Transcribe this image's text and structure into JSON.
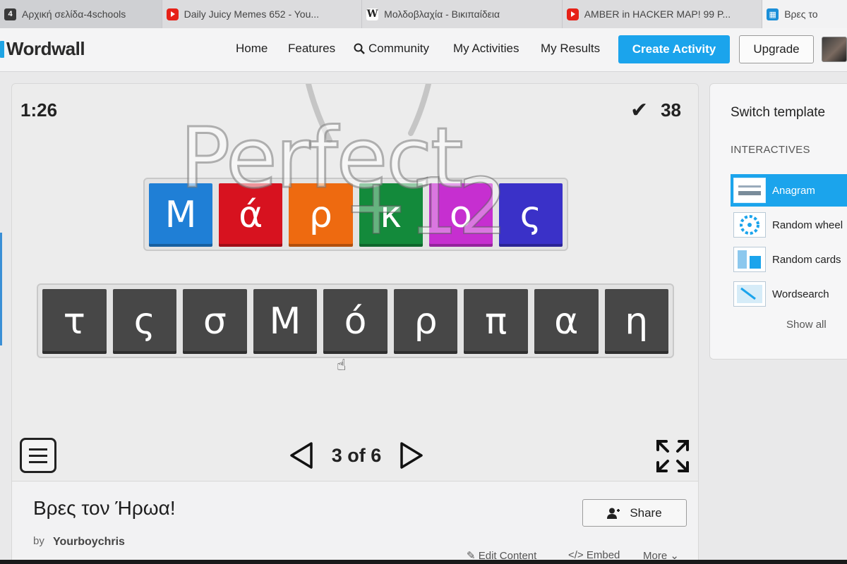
{
  "browser": {
    "tabs": [
      {
        "icon": "4schools-favicon",
        "label": "Αρχική σελίδα-4schools"
      },
      {
        "icon": "youtube-icon",
        "label": "Daily Juicy Memes 652 - You..."
      },
      {
        "icon": "wikipedia-icon",
        "label": "Μολδοβλαχία - Βικιπαίδεια"
      },
      {
        "icon": "youtube-icon",
        "label": "AMBER in HACKER MAP! 99 P..."
      },
      {
        "icon": "wordwall-favicon",
        "label": "Βρες το"
      }
    ]
  },
  "header": {
    "logo": "Wordwall",
    "nav": [
      "Home",
      "Features",
      "Community",
      "My Activities",
      "My Results"
    ],
    "create_label": "Create Activity",
    "upgrade_label": "Upgrade"
  },
  "game": {
    "timer": "1:26",
    "score": "38",
    "overlay_text": "Perfect",
    "bonus_text": "+12",
    "answer_letters": [
      "Μ",
      "ά",
      "ρ",
      "κ",
      "ο",
      "ς"
    ],
    "answer_colors": [
      "#1f7fd6",
      "#d7121f",
      "#ee6a10",
      "#138a3b",
      "#c62fd0",
      "#3a31c8"
    ],
    "pool_letters": [
      "τ",
      "ς",
      "σ",
      "Μ",
      "ό",
      "ρ",
      "π",
      "α",
      "η"
    ],
    "page": "3 of 6"
  },
  "activity": {
    "title": "Βρες τον Ήρωα!",
    "by_label": "by",
    "author": "Yourboychris",
    "share_label": "Share",
    "edit_label": "Edit Content",
    "embed_label": "Embed",
    "more_label": "More"
  },
  "sidebar": {
    "title": "Switch template",
    "section": "INTERACTIVES",
    "templates": [
      "Anagram",
      "Random wheel",
      "Random cards",
      "Wordsearch"
    ],
    "show_all": "Show all"
  }
}
